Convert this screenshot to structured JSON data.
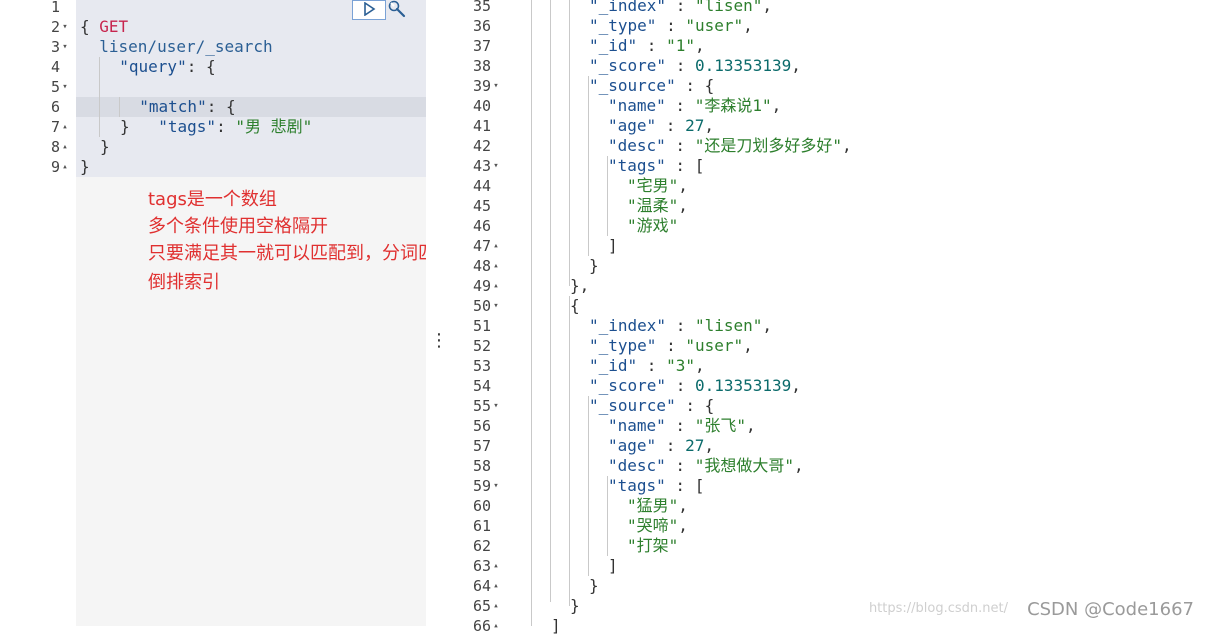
{
  "request": {
    "method": "GET",
    "path": "lisen/user/_search",
    "line_numbers": [
      "1",
      "2",
      "3",
      "4",
      "5",
      "6",
      "7",
      "8",
      "9"
    ],
    "fold_markers": [
      "",
      "▾",
      "▾",
      "",
      "▾",
      "",
      "▴",
      "▴",
      "▴"
    ],
    "lines": {
      "l2": "{",
      "l3_key": "\"query\"",
      "l3_rest": ": {",
      "l5_key": "\"match\"",
      "l5_rest": ": {",
      "l6_key": "\"tags\"",
      "l6_colon": ": ",
      "l6_val": "\"男 悲剧\"",
      "l7": "}",
      "l8": "}",
      "l9": "}"
    },
    "run_icon": "play-icon",
    "settings_icon": "wrench-icon"
  },
  "annotation": {
    "line1": "tags是一个数组",
    "line2": "多个条件使用空格隔开",
    "line3": "只要满足其一就可以匹配到，分词匹配",
    "line4": "倒排索引"
  },
  "splitter": {
    "icon": "vertical-dots-icon",
    "glyph": "⋮"
  },
  "response": {
    "line_numbers": [
      "35",
      "36",
      "37",
      "38",
      "39",
      "40",
      "41",
      "42",
      "43",
      "44",
      "45",
      "46",
      "47",
      "48",
      "49",
      "50",
      "51",
      "52",
      "53",
      "54",
      "55",
      "56",
      "57",
      "58",
      "59",
      "60",
      "61",
      "62",
      "63",
      "64",
      "65",
      "66"
    ],
    "fold_markers": [
      "",
      "",
      "",
      "",
      "▾",
      "",
      "",
      "",
      "▾",
      "",
      "",
      "",
      "▴",
      "▴",
      "▴",
      "▾",
      "",
      "",
      "",
      "",
      "▾",
      "",
      "",
      "",
      "▾",
      "",
      "",
      "",
      "▴",
      "▴",
      "▴",
      "▴"
    ],
    "lines": [
      {
        "indent": 2,
        "parts": [
          [
            "key",
            "\"_index\""
          ],
          [
            "punc",
            " : "
          ],
          [
            "str",
            "\"lisen\""
          ],
          [
            "punc",
            ","
          ]
        ]
      },
      {
        "indent": 2,
        "parts": [
          [
            "key",
            "\"_type\""
          ],
          [
            "punc",
            " : "
          ],
          [
            "str",
            "\"user\""
          ],
          [
            "punc",
            ","
          ]
        ]
      },
      {
        "indent": 2,
        "parts": [
          [
            "key",
            "\"_id\""
          ],
          [
            "punc",
            " : "
          ],
          [
            "str",
            "\"1\""
          ],
          [
            "punc",
            ","
          ]
        ]
      },
      {
        "indent": 2,
        "parts": [
          [
            "key",
            "\"_score\""
          ],
          [
            "punc",
            " : "
          ],
          [
            "num",
            "0.13353139"
          ],
          [
            "punc",
            ","
          ]
        ]
      },
      {
        "indent": 2,
        "parts": [
          [
            "key",
            "\"_source\""
          ],
          [
            "punc",
            " : {"
          ]
        ]
      },
      {
        "indent": 3,
        "parts": [
          [
            "key",
            "\"name\""
          ],
          [
            "punc",
            " : "
          ],
          [
            "str",
            "\"李森说1\""
          ],
          [
            "punc",
            ","
          ]
        ]
      },
      {
        "indent": 3,
        "parts": [
          [
            "key",
            "\"age\""
          ],
          [
            "punc",
            " : "
          ],
          [
            "num",
            "27"
          ],
          [
            "punc",
            ","
          ]
        ]
      },
      {
        "indent": 3,
        "parts": [
          [
            "key",
            "\"desc\""
          ],
          [
            "punc",
            " : "
          ],
          [
            "str",
            "\"还是刀划多好多好\""
          ],
          [
            "punc",
            ","
          ]
        ]
      },
      {
        "indent": 3,
        "parts": [
          [
            "key",
            "\"tags\""
          ],
          [
            "punc",
            " : ["
          ]
        ]
      },
      {
        "indent": 4,
        "parts": [
          [
            "str",
            "\"宅男\""
          ],
          [
            "punc",
            ","
          ]
        ]
      },
      {
        "indent": 4,
        "parts": [
          [
            "str",
            "\"温柔\""
          ],
          [
            "punc",
            ","
          ]
        ]
      },
      {
        "indent": 4,
        "parts": [
          [
            "str",
            "\"游戏\""
          ]
        ]
      },
      {
        "indent": 3,
        "parts": [
          [
            "punc",
            "]"
          ]
        ]
      },
      {
        "indent": 2,
        "parts": [
          [
            "punc",
            "}"
          ]
        ]
      },
      {
        "indent": 1,
        "parts": [
          [
            "punc",
            "},"
          ]
        ]
      },
      {
        "indent": 1,
        "parts": [
          [
            "punc",
            "{"
          ]
        ]
      },
      {
        "indent": 2,
        "parts": [
          [
            "key",
            "\"_index\""
          ],
          [
            "punc",
            " : "
          ],
          [
            "str",
            "\"lisen\""
          ],
          [
            "punc",
            ","
          ]
        ]
      },
      {
        "indent": 2,
        "parts": [
          [
            "key",
            "\"_type\""
          ],
          [
            "punc",
            " : "
          ],
          [
            "str",
            "\"user\""
          ],
          [
            "punc",
            ","
          ]
        ]
      },
      {
        "indent": 2,
        "parts": [
          [
            "key",
            "\"_id\""
          ],
          [
            "punc",
            " : "
          ],
          [
            "str",
            "\"3\""
          ],
          [
            "punc",
            ","
          ]
        ]
      },
      {
        "indent": 2,
        "parts": [
          [
            "key",
            "\"_score\""
          ],
          [
            "punc",
            " : "
          ],
          [
            "num",
            "0.13353139"
          ],
          [
            "punc",
            ","
          ]
        ]
      },
      {
        "indent": 2,
        "parts": [
          [
            "key",
            "\"_source\""
          ],
          [
            "punc",
            " : {"
          ]
        ]
      },
      {
        "indent": 3,
        "parts": [
          [
            "key",
            "\"name\""
          ],
          [
            "punc",
            " : "
          ],
          [
            "str",
            "\"张飞\""
          ],
          [
            "punc",
            ","
          ]
        ]
      },
      {
        "indent": 3,
        "parts": [
          [
            "key",
            "\"age\""
          ],
          [
            "punc",
            " : "
          ],
          [
            "num",
            "27"
          ],
          [
            "punc",
            ","
          ]
        ]
      },
      {
        "indent": 3,
        "parts": [
          [
            "key",
            "\"desc\""
          ],
          [
            "punc",
            " : "
          ],
          [
            "str",
            "\"我想做大哥\""
          ],
          [
            "punc",
            ","
          ]
        ]
      },
      {
        "indent": 3,
        "parts": [
          [
            "key",
            "\"tags\""
          ],
          [
            "punc",
            " : ["
          ]
        ]
      },
      {
        "indent": 4,
        "parts": [
          [
            "str",
            "\"猛男\""
          ],
          [
            "punc",
            ","
          ]
        ]
      },
      {
        "indent": 4,
        "parts": [
          [
            "str",
            "\"哭啼\""
          ],
          [
            "punc",
            ","
          ]
        ]
      },
      {
        "indent": 4,
        "parts": [
          [
            "str",
            "\"打架\""
          ]
        ]
      },
      {
        "indent": 3,
        "parts": [
          [
            "punc",
            "]"
          ]
        ]
      },
      {
        "indent": 2,
        "parts": [
          [
            "punc",
            "}"
          ]
        ]
      },
      {
        "indent": 1,
        "parts": [
          [
            "punc",
            "}"
          ]
        ]
      },
      {
        "indent": 0,
        "parts": [
          [
            "punc",
            "]"
          ]
        ]
      }
    ]
  },
  "watermark": {
    "text": "CSDN @Code1667",
    "faint_text": "https://blog.csdn.net/"
  },
  "colors": {
    "annotation": "#e03030",
    "string": "#2d7f2d",
    "key": "#1c4f8f",
    "number": "#0b6b6b",
    "method": "#c7254e"
  }
}
